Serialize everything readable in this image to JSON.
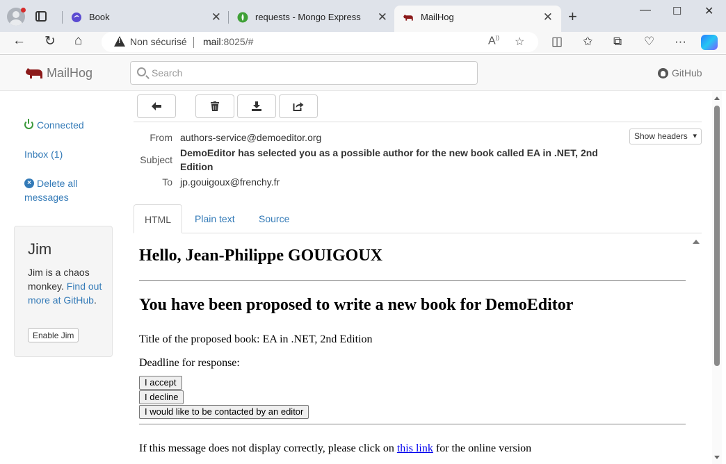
{
  "browser": {
    "tabs": [
      {
        "label": "Book",
        "icon": "book-favicon"
      },
      {
        "label": "requests - Mongo Express",
        "icon": "mongo-express-favicon"
      },
      {
        "label": "MailHog",
        "icon": "mailhog-favicon",
        "active": true
      }
    ],
    "address": {
      "security_label": "Non sécurisé",
      "url_host": "mail",
      "url_rest": ":8025/#"
    }
  },
  "navbar": {
    "brand": "MailHog",
    "search_placeholder": "Search",
    "github": "GitHub"
  },
  "sidebar": {
    "connected": "Connected",
    "inbox": "Inbox (1)",
    "delete_all": "Delete all messages"
  },
  "jim": {
    "title": "Jim",
    "text_1": "Jim is a chaos monkey.",
    "link": "Find out more at GitHub",
    "period": ".",
    "button": "Enable Jim"
  },
  "message": {
    "from_label": "From",
    "from": "authors-service@demoeditor.org",
    "subject_label": "Subject",
    "subject": "DemoEditor has selected you as a possible author for the new book called EA in .NET, 2nd Edition",
    "to_label": "To",
    "to": "jp.gouigoux@frenchy.fr",
    "show_headers": "Show headers"
  },
  "preview_tabs": [
    "HTML",
    "Plain text",
    "Source"
  ],
  "email": {
    "greeting": "Hello, Jean-Philippe GOUIGOUX",
    "heading": "You have been proposed to write a new book for DemoEditor",
    "title_line": "Title of the proposed book: EA in .NET, 2nd Edition",
    "deadline": "Deadline for response:",
    "btn_accept": "I accept",
    "btn_decline": "I decline",
    "btn_contact": "I would like to be contacted by an editor",
    "footer_before": "If this message does not display correctly, please click on",
    "footer_link": "this link",
    "footer_after": "for the online version"
  },
  "colors": {
    "link": "#337ab7",
    "connected": "#3c9a3c",
    "brand": "#8b1a1a"
  }
}
